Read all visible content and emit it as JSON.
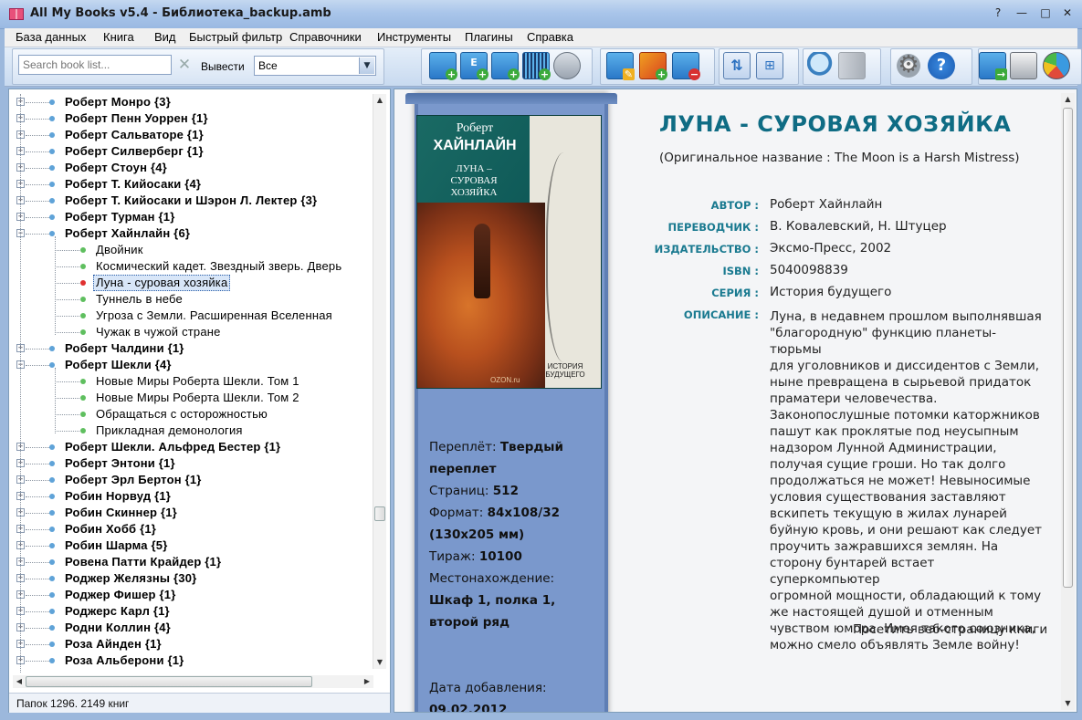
{
  "window": {
    "title": "All My Books v5.4 - Библиотека_backup.amb",
    "buttons": {
      "help": "?",
      "minimize": "—",
      "maximize": "□",
      "close": "✕"
    }
  },
  "menu": [
    {
      "label": "База данных"
    },
    {
      "label": "Книга"
    },
    {
      "label": "Вид"
    },
    {
      "label": "Быстрый фильтр"
    },
    {
      "label": "Справочники"
    },
    {
      "label": "Инструменты"
    },
    {
      "label": "Плагины"
    },
    {
      "label": "Справка"
    }
  ],
  "toolbar": {
    "search_placeholder": "Search book list...",
    "search_value": "",
    "show_label": "Вывести",
    "show_value": "Все",
    "icons": [
      {
        "name": "add-book-icon"
      },
      {
        "name": "add-ebook-icon"
      },
      {
        "name": "add-audiobook-icon"
      },
      {
        "name": "add-by-barcode-icon"
      },
      {
        "name": "search-online-icon"
      },
      {
        "name": "edit-book-icon"
      },
      {
        "name": "edit-cover-icon"
      },
      {
        "name": "delete-book-icon"
      },
      {
        "name": "sort-icon"
      },
      {
        "name": "tree-view-icon"
      },
      {
        "name": "find-icon"
      },
      {
        "name": "book-view-icon"
      },
      {
        "name": "settings-icon"
      },
      {
        "name": "help-icon"
      },
      {
        "name": "export-icon"
      },
      {
        "name": "print-icon"
      },
      {
        "name": "statistics-icon"
      }
    ]
  },
  "tree": {
    "rows": [
      {
        "label": "Роберт Монро {3}",
        "level": 0
      },
      {
        "label": "Роберт Пенн Уоррен {1}",
        "level": 0
      },
      {
        "label": "Роберт Сальваторе {1}",
        "level": 0
      },
      {
        "label": "Роберт Силверберг {1}",
        "level": 0
      },
      {
        "label": "Роберт Стоун {4}",
        "level": 0
      },
      {
        "label": "Роберт Т. Кийосаки {4}",
        "level": 0
      },
      {
        "label": "Роберт Т. Кийосаки и Шэрон Л. Лектер {3}",
        "level": 0
      },
      {
        "label": "Роберт Турман {1}",
        "level": 0
      },
      {
        "label": "Роберт Хайнлайн {6}",
        "level": 0,
        "expanded": true
      },
      {
        "label": "Двойник",
        "level": 1
      },
      {
        "label": "Космический кадет. Звездный зверь. Дверь",
        "level": 1
      },
      {
        "label": "Луна - суровая хозяйка",
        "level": 1,
        "selected": true
      },
      {
        "label": "Туннель в небе",
        "level": 1
      },
      {
        "label": "Угроза с Земли. Расширенная Вселенная",
        "level": 1
      },
      {
        "label": "Чужак в чужой стране",
        "level": 1
      },
      {
        "label": "Роберт Чалдини {1}",
        "level": 0
      },
      {
        "label": "Роберт Шекли {4}",
        "level": 0,
        "expanded": true
      },
      {
        "label": "Новые Миры Роберта Шекли. Том 1",
        "level": 1
      },
      {
        "label": "Новые Миры Роберта Шекли. Том 2",
        "level": 1
      },
      {
        "label": "Обращаться с осторожностью",
        "level": 1
      },
      {
        "label": "Прикладная демонология",
        "level": 1
      },
      {
        "label": "Роберт Шекли. Альфред Бестер {1}",
        "level": 0
      },
      {
        "label": "Роберт Энтони {1}",
        "level": 0
      },
      {
        "label": "Роберт Эрл Бертон {1}",
        "level": 0
      },
      {
        "label": "Робин Норвуд {1}",
        "level": 0
      },
      {
        "label": "Робин Скиннер {1}",
        "level": 0
      },
      {
        "label": "Робин Хобб {1}",
        "level": 0
      },
      {
        "label": "Робин Шарма {5}",
        "level": 0
      },
      {
        "label": "Ровена Патти Крайдер {1}",
        "level": 0
      },
      {
        "label": "Роджер Желязны {30}",
        "level": 0
      },
      {
        "label": "Роджер Фишер {1}",
        "level": 0
      },
      {
        "label": "Роджерс Карл {1}",
        "level": 0
      },
      {
        "label": "Родни Коллин {4}",
        "level": 0
      },
      {
        "label": "Роза Айнден {1}",
        "level": 0
      },
      {
        "label": "Роза Альберони {1}",
        "level": 0
      }
    ]
  },
  "status": {
    "text": "Папок 1296.  2149 книг"
  },
  "cover": {
    "author_first": "Роберт",
    "author_last": "ХАЙНЛАЙН",
    "title_line1": "ЛУНА –",
    "title_line2": "СУРОВАЯ",
    "title_line3": "ХОЗЯЙКА",
    "series_line1": "ИСТОРИЯ",
    "series_line2": "БУДУЩЕГО",
    "watermark": "OZON.ru"
  },
  "meta": {
    "binding_label": "Переплёт:",
    "binding_value": "Твердый переплет",
    "pages_label": "Страниц:",
    "pages_value": "512",
    "format_label": "Формат:",
    "format_value": "84x108/32 (130x205 мм)",
    "print_run_label": "Тираж:",
    "print_run_value": "10100",
    "location_label": "Местонахождение:",
    "location_value": "Шкаф 1, полка 1, второй ряд",
    "added_label": "Дата добавления:",
    "added_value": "09.02.2012"
  },
  "book": {
    "title": "ЛУНА - СУРОВАЯ ХОЗЯЙКА",
    "original_title": "(Оригинальное название : The Moon is a Harsh Mistress)",
    "fields": [
      {
        "label": "АВТОР :",
        "value": "Роберт Хайнлайн"
      },
      {
        "label": "ПЕРЕВОДЧИК :",
        "value": "В. Ковалевский, Н. Штуцер"
      },
      {
        "label": "ИЗДАТЕЛЬСТВО :",
        "value": "Эксмо-Пресс, 2002"
      },
      {
        "label": "ISBN :",
        "value": "5040098839"
      },
      {
        "label": "СЕРИЯ :",
        "value": "История будущего"
      },
      {
        "label": "ОПИСАНИЕ :",
        "value": ""
      }
    ],
    "description": [
      "Луна, в недавнем прошлом выполнявшая",
      "\"благородную\" функцию планеты-тюрьмы",
      "для уголовников и диссидентов с Земли,",
      "ныне превращена в сырьевой придаток",
      "праматери человечества.",
      "Законопослушные потомки каторжников",
      "пашут как проклятые под неусыпным",
      "надзором Лунной Администрации,",
      "получая сущие гроши. Но так долго",
      "продолжаться не может! Невыносимые",
      "условия существования заставляют",
      "вскипеть текущую в жилах лунарей",
      "буйную кровь, и они решают как следует",
      "проучить зажравшихся землян. На",
      "сторону бунтарей встает суперкомпьютер",
      "огромной мощности, обладающий к тому",
      "же настоящей душой и отменным",
      "чувством юмора. Имея такого союзника,",
      "можно смело объявлять Земле войну!"
    ],
    "visit_link": "Посетить веб-страницу книги"
  },
  "colors": {
    "accent": "#0f6c84",
    "label": "#1a7a90",
    "cover_column": "#7a98cc"
  }
}
